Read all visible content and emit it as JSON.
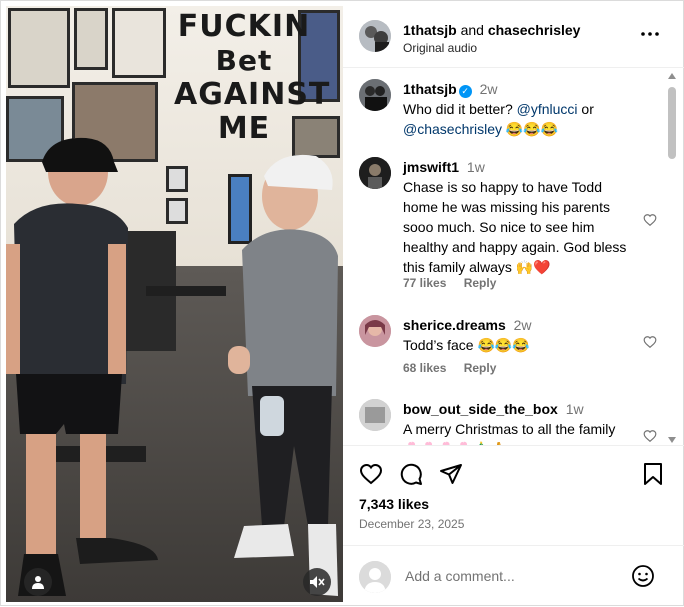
{
  "header": {
    "user1": "1thatsjb",
    "and": "and",
    "user2": "chasechrisley",
    "audio": "Original audio"
  },
  "media": {
    "wall_text_line1": "FUCKIN",
    "wall_text_line2": "Bet",
    "wall_text_line3": "AGAINST",
    "wall_text_line4": "ME",
    "mute_icon": "speaker-muted-icon",
    "tag_icon": "person-tag-icon"
  },
  "caption": {
    "user": "1thatsjb",
    "time": "2w",
    "text_pre": "Who did it better? ",
    "mention1": "@yfnlucci",
    "text_mid": " or",
    "mention2": "@chasechrisley",
    "emoji": " 😂😂😂"
  },
  "comments": [
    {
      "user": "jmswift1",
      "time": "1w",
      "text": "Chase is so happy to have Todd home he was missing his parents sooo much. So nice to see him healthy and happy again. God bless this family always 🙌❤️",
      "likes": "77 likes",
      "reply": "Reply"
    },
    {
      "user": "sherice.dreams",
      "time": "2w",
      "text": "Todd’s face 😂😂😂",
      "likes": "68 likes",
      "reply": "Reply"
    },
    {
      "user": "bow_out_side_the_box",
      "time": "1w",
      "text": "A merry Christmas to all the family 🌸🌸🌸🌸🎄🙏"
    }
  ],
  "post": {
    "likes": "7,343 likes",
    "date": "December 23, 2025"
  },
  "add_comment": {
    "placeholder": "Add a comment..."
  },
  "colors": {
    "link": "#00376b",
    "secondary": "#737373",
    "like_red": "#ed4956",
    "verified": "#0095f6"
  }
}
